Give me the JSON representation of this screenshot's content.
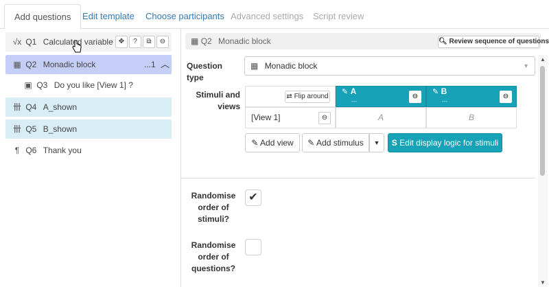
{
  "tabs": [
    {
      "label": "Add questions"
    },
    {
      "label": "Edit template"
    },
    {
      "label": "Choose participants"
    },
    {
      "label": "Advanced settings"
    },
    {
      "label": "Script review"
    }
  ],
  "questions": [
    {
      "icon": "√x",
      "num": "Q1",
      "title": "Calculated variable",
      "selected": false
    },
    {
      "icon": "▦",
      "num": "Q2",
      "title": "Monadic block",
      "count": "...1",
      "selected": true
    },
    {
      "icon": "▣",
      "num": "Q3",
      "title": "Do you like [View 1] ?"
    },
    {
      "icon": "卌",
      "num": "Q4",
      "title": "A_shown"
    },
    {
      "icon": "卌",
      "num": "Q5",
      "title": "B_shown"
    },
    {
      "icon": "¶",
      "num": "Q6",
      "title": "Thank you"
    }
  ],
  "panel": {
    "num": "Q2",
    "title": "Monadic block",
    "review_btn": "Review sequence of questions",
    "qtype_label": "Question type",
    "qtype_value": "Monadic block",
    "stimuli_label": "Stimuli and views",
    "flip_btn": "Flip around",
    "stimuli": [
      {
        "name": "A",
        "sub": "---",
        "cell": "A"
      },
      {
        "name": "B",
        "sub": "---",
        "cell": "B"
      }
    ],
    "view": "[View 1]",
    "add_view": "Add view",
    "add_stimulus": "Add stimulus",
    "display_logic": "Edit display logic for stimuli",
    "rand_stimuli_label": "Randomise order of stimuli?",
    "rand_stimuli_checked": true,
    "rand_questions_label": "Randomise order of questions?",
    "rand_questions_checked": false
  }
}
